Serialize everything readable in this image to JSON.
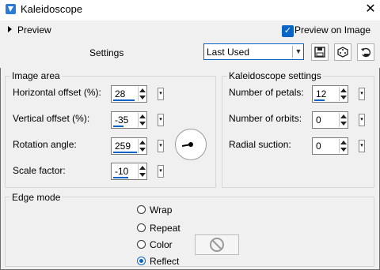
{
  "window": {
    "title": "Kaleidoscope",
    "close_glyph": "✕"
  },
  "preview": {
    "label": "Preview",
    "checkbox_label": "Preview on Image",
    "checked": true
  },
  "settings": {
    "label": "Settings",
    "preset_value": "Last Used"
  },
  "image_area": {
    "title": "Image area",
    "fields": [
      {
        "label": "Horizontal offset (%):",
        "value": "28",
        "fill": 0.64
      },
      {
        "label": "Vertical offset (%):",
        "value": "-35",
        "fill": 0.32
      },
      {
        "label": "Rotation angle:",
        "value": "259",
        "fill": 0.72
      },
      {
        "label": "Scale factor:",
        "value": "-10",
        "fill": 0.45
      }
    ]
  },
  "kaleidoscope_settings": {
    "title": "Kaleidoscope settings",
    "fields": [
      {
        "label": "Number of petals:",
        "value": "12",
        "fill": 0.32
      },
      {
        "label": "Number of orbits:",
        "value": "0",
        "fill": 0.0
      },
      {
        "label": "Radial suction:",
        "value": "0",
        "fill": 0.0
      }
    ]
  },
  "edge_mode": {
    "title": "Edge mode",
    "options": [
      "Wrap",
      "Repeat",
      "Color",
      "Reflect"
    ],
    "selected": "Reflect"
  },
  "colors": {
    "accent": "#0a64c8"
  }
}
